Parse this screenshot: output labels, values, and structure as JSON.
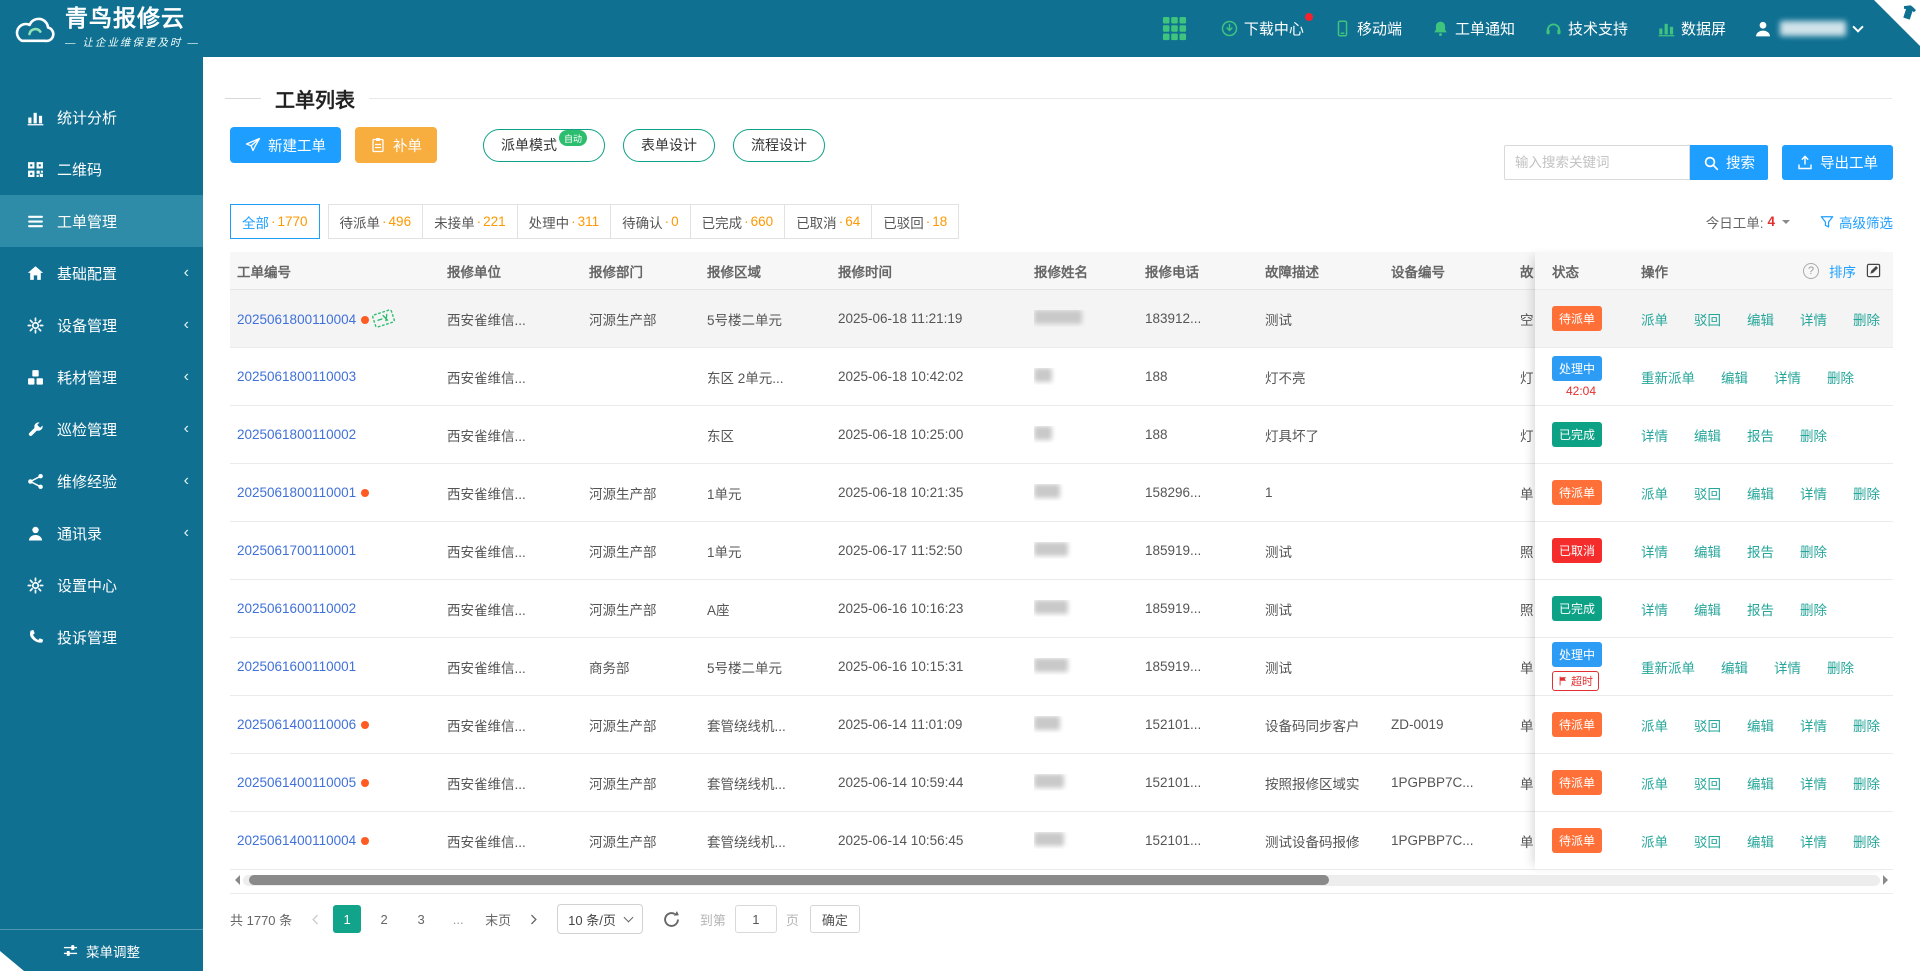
{
  "brand": {
    "name": "青鸟报修云",
    "tagline": "— 让企业维保更及时 —"
  },
  "topnav": [
    {
      "id": "download-center",
      "label": "下载中心",
      "icon": "cloud-download",
      "dot": true
    },
    {
      "id": "mobile",
      "label": "移动端",
      "icon": "mobile"
    },
    {
      "id": "order-notify",
      "label": "工单通知",
      "icon": "bell"
    },
    {
      "id": "tech-support",
      "label": "技术支持",
      "icon": "headset"
    },
    {
      "id": "data-screen",
      "label": "数据屏",
      "icon": "chart"
    }
  ],
  "sidebar": {
    "items": [
      {
        "id": "stats",
        "label": "统计分析",
        "icon": "chart"
      },
      {
        "id": "qrcode",
        "label": "二维码",
        "icon": "qr"
      },
      {
        "id": "orders",
        "label": "工单管理",
        "icon": "menu",
        "active": true
      },
      {
        "id": "base-config",
        "label": "基础配置",
        "icon": "home",
        "chevron": true
      },
      {
        "id": "devices",
        "label": "设备管理",
        "icon": "gear",
        "chevron": true
      },
      {
        "id": "consumables",
        "label": "耗材管理",
        "icon": "cubes",
        "chevron": true
      },
      {
        "id": "inspection",
        "label": "巡检管理",
        "icon": "wrench",
        "chevron": true
      },
      {
        "id": "experience",
        "label": "维修经验",
        "icon": "share",
        "chevron": true
      },
      {
        "id": "contacts",
        "label": "通讯录",
        "icon": "user",
        "chevron": true
      },
      {
        "id": "settings",
        "label": "设置中心",
        "icon": "gear"
      },
      {
        "id": "complaints",
        "label": "投诉管理",
        "icon": "phone-handset"
      }
    ],
    "footer": "菜单调整"
  },
  "page": {
    "title": "工单列表"
  },
  "toolbar": {
    "new": "新建工单",
    "supplement": "补单",
    "dispatch": "派单模式",
    "dispatch_badge": "自动",
    "form": "表单设计",
    "flow": "流程设计"
  },
  "search": {
    "placeholder": "输入搜索关键词",
    "button": "搜索",
    "export": "导出工单"
  },
  "filters": {
    "tabs": [
      {
        "label": "全部",
        "count": "1770",
        "active": true
      },
      {
        "label": "待派单",
        "count": "496"
      },
      {
        "label": "未接单",
        "count": "221"
      },
      {
        "label": "处理中",
        "count": "311"
      },
      {
        "label": "待确认",
        "count": "0"
      },
      {
        "label": "已完成",
        "count": "660"
      },
      {
        "label": "已取消",
        "count": "64"
      },
      {
        "label": "已驳回",
        "count": "18"
      }
    ],
    "today_label": "今日工单:",
    "today_count": "4",
    "advanced": "高级筛选"
  },
  "table": {
    "columns": [
      "工单编号",
      "报修单位",
      "报修部门",
      "报修区域",
      "报修时间",
      "报修姓名",
      "报修电话",
      "故障描述",
      "设备编号",
      "故"
    ],
    "rows": [
      {
        "no": "2025061800110004",
        "dot": true,
        "stamp": true,
        "unit": "西安雀维信...",
        "dept": "河源生产部",
        "area": "5号楼二单元",
        "time": "2025-06-18 11:21:19",
        "name_blur_w": 48,
        "phone": "183912...",
        "desc": "测试",
        "device": "",
        "clip": "空",
        "status": "待派单",
        "status_type": "pending",
        "actions": [
          "派单",
          "驳回",
          "编辑",
          "详情",
          "删除"
        ],
        "highlight": true
      },
      {
        "no": "2025061800110003",
        "dot": false,
        "unit": "西安雀维信...",
        "dept": "",
        "area": "东区 2单元...",
        "time": "2025-06-18 10:42:02",
        "name_blur_w": 18,
        "phone": "188",
        "desc": "灯不亮",
        "device": "",
        "clip": "灯",
        "status": "处理中",
        "status_type": "processing",
        "timer": "42:04",
        "actions": [
          "重新派单",
          "编辑",
          "详情",
          "删除"
        ]
      },
      {
        "no": "2025061800110002",
        "dot": false,
        "unit": "西安雀维信...",
        "dept": "",
        "area": "东区",
        "time": "2025-06-18 10:25:00",
        "name_blur_w": 18,
        "phone": "188",
        "desc": "灯具坏了",
        "device": "",
        "clip": "灯",
        "status": "已完成",
        "status_type": "done",
        "actions": [
          "详情",
          "编辑",
          "报告",
          "删除"
        ]
      },
      {
        "no": "2025061800110001",
        "dot": true,
        "unit": "西安雀维信...",
        "dept": "河源生产部",
        "area": "1单元",
        "time": "2025-06-18 10:21:35",
        "name_blur_w": 26,
        "phone": "158296...",
        "desc": "1",
        "device": "",
        "clip": "单",
        "status": "待派单",
        "status_type": "pending",
        "actions": [
          "派单",
          "驳回",
          "编辑",
          "详情",
          "删除"
        ]
      },
      {
        "no": "2025061700110001",
        "dot": false,
        "unit": "西安雀维信...",
        "dept": "河源生产部",
        "area": "1单元",
        "time": "2025-06-17 11:52:50",
        "name_blur_w": 34,
        "phone": "185919...",
        "desc": "测试",
        "device": "",
        "clip": "照",
        "status": "已取消",
        "status_type": "cancelled",
        "actions": [
          "详情",
          "编辑",
          "报告",
          "删除"
        ]
      },
      {
        "no": "2025061600110002",
        "dot": false,
        "unit": "西安雀维信...",
        "dept": "河源生产部",
        "area": "A座",
        "time": "2025-06-16 10:16:23",
        "name_blur_w": 34,
        "phone": "185919...",
        "desc": "测试",
        "device": "",
        "clip": "照",
        "status": "已完成",
        "status_type": "done",
        "actions": [
          "详情",
          "编辑",
          "报告",
          "删除"
        ]
      },
      {
        "no": "2025061600110001",
        "dot": false,
        "unit": "西安雀维信...",
        "dept": "商务部",
        "area": "5号楼二单元",
        "time": "2025-06-16 10:15:31",
        "name_blur_w": 34,
        "phone": "185919...",
        "desc": "测试",
        "device": "",
        "clip": "单",
        "status": "处理中",
        "status_type": "processing",
        "overtime": "超时",
        "actions": [
          "重新派单",
          "编辑",
          "详情",
          "删除"
        ]
      },
      {
        "no": "2025061400110006",
        "dot": true,
        "unit": "西安雀维信...",
        "dept": "河源生产部",
        "area": "套管绕线机...",
        "time": "2025-06-14 11:01:09",
        "name_blur_w": 26,
        "phone": "152101...",
        "desc": "设备码同步客户",
        "device": "ZD-0019",
        "clip": "单",
        "status": "待派单",
        "status_type": "pending",
        "actions": [
          "派单",
          "驳回",
          "编辑",
          "详情",
          "删除"
        ]
      },
      {
        "no": "2025061400110005",
        "dot": true,
        "unit": "西安雀维信...",
        "dept": "河源生产部",
        "area": "套管绕线机...",
        "time": "2025-06-14 10:59:44",
        "name_blur_w": 30,
        "phone": "152101...",
        "desc": "按照报修区域实",
        "device": "1PGPBP7C...",
        "clip": "单",
        "status": "待派单",
        "status_type": "pending",
        "actions": [
          "派单",
          "驳回",
          "编辑",
          "详情",
          "删除"
        ]
      },
      {
        "no": "2025061400110004",
        "dot": true,
        "unit": "西安雀维信...",
        "dept": "河源生产部",
        "area": "套管绕线机...",
        "time": "2025-06-14 10:56:45",
        "name_blur_w": 30,
        "phone": "152101...",
        "desc": "测试设备码报修",
        "device": "1PGPBP7C...",
        "clip": "单",
        "status": "待派单",
        "status_type": "pending",
        "actions": [
          "派单",
          "驳回",
          "编辑",
          "详情",
          "删除"
        ]
      }
    ]
  },
  "panel": {
    "status_col": "状态",
    "action_col": "操作",
    "help": "?",
    "sort": "排序"
  },
  "pagination": {
    "total": "共 1770 条",
    "pages": [
      "1",
      "2",
      "3",
      "...",
      "末页"
    ],
    "active_page": "1",
    "page_size": "10 条/页",
    "jump_prefix": "到第",
    "jump_value": "1",
    "jump_suffix": "页",
    "confirm": "确定"
  },
  "colors": {
    "header_teal": "#0F7092",
    "sidebar_active": "#2E8CA9",
    "accent_blue": "#1E9FFF",
    "warning_orange": "#F7AE3F",
    "count_orange": "#FF9800",
    "order_link_blue": "#4071D9",
    "action_teal": "#26A69A",
    "nav_icon_green": "#3FC47E",
    "status_pending": "#FF7038",
    "status_processing": "#2D9CF4",
    "status_done": "#0DA186",
    "status_cancelled": "#F52C2C",
    "overdue_red": "#E23030",
    "pagination_active": "#12A48B"
  }
}
